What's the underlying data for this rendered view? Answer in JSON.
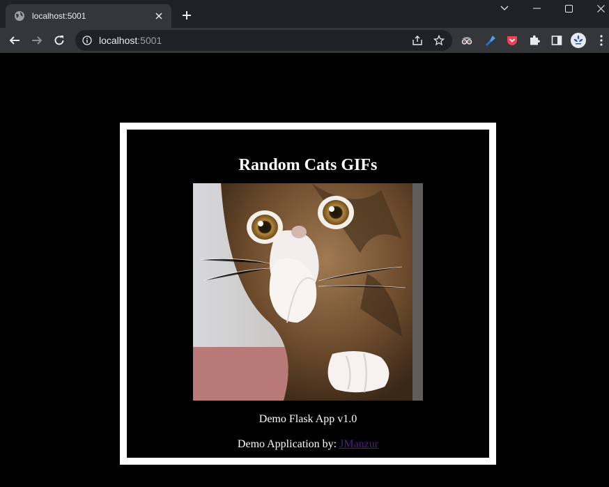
{
  "browser": {
    "tab": {
      "title": "localhost:5001",
      "favicon": "globe-icon"
    },
    "address": {
      "host": "localhost",
      "port": ":5001"
    },
    "colors": {
      "frame": "#202124",
      "toolbar": "#35363a",
      "text": "#e8eaed",
      "muted": "#9aa0a6"
    },
    "extensions": [
      "spy-glasses-icon",
      "pen-tool-icon",
      "pocket-icon",
      "puzzle-icon",
      "side-panel-icon",
      "profile-avatar-icon"
    ]
  },
  "page": {
    "title": "Random Cats GIFs",
    "image_subject": "kitten",
    "version": "Demo Flask App v1.0",
    "credit_prefix": "Demo Application by: ",
    "credit_link": "JManzur",
    "colors": {
      "background": "#000000",
      "border": "#ffffff",
      "text": "#ffffff",
      "link": "#551a8b"
    }
  }
}
